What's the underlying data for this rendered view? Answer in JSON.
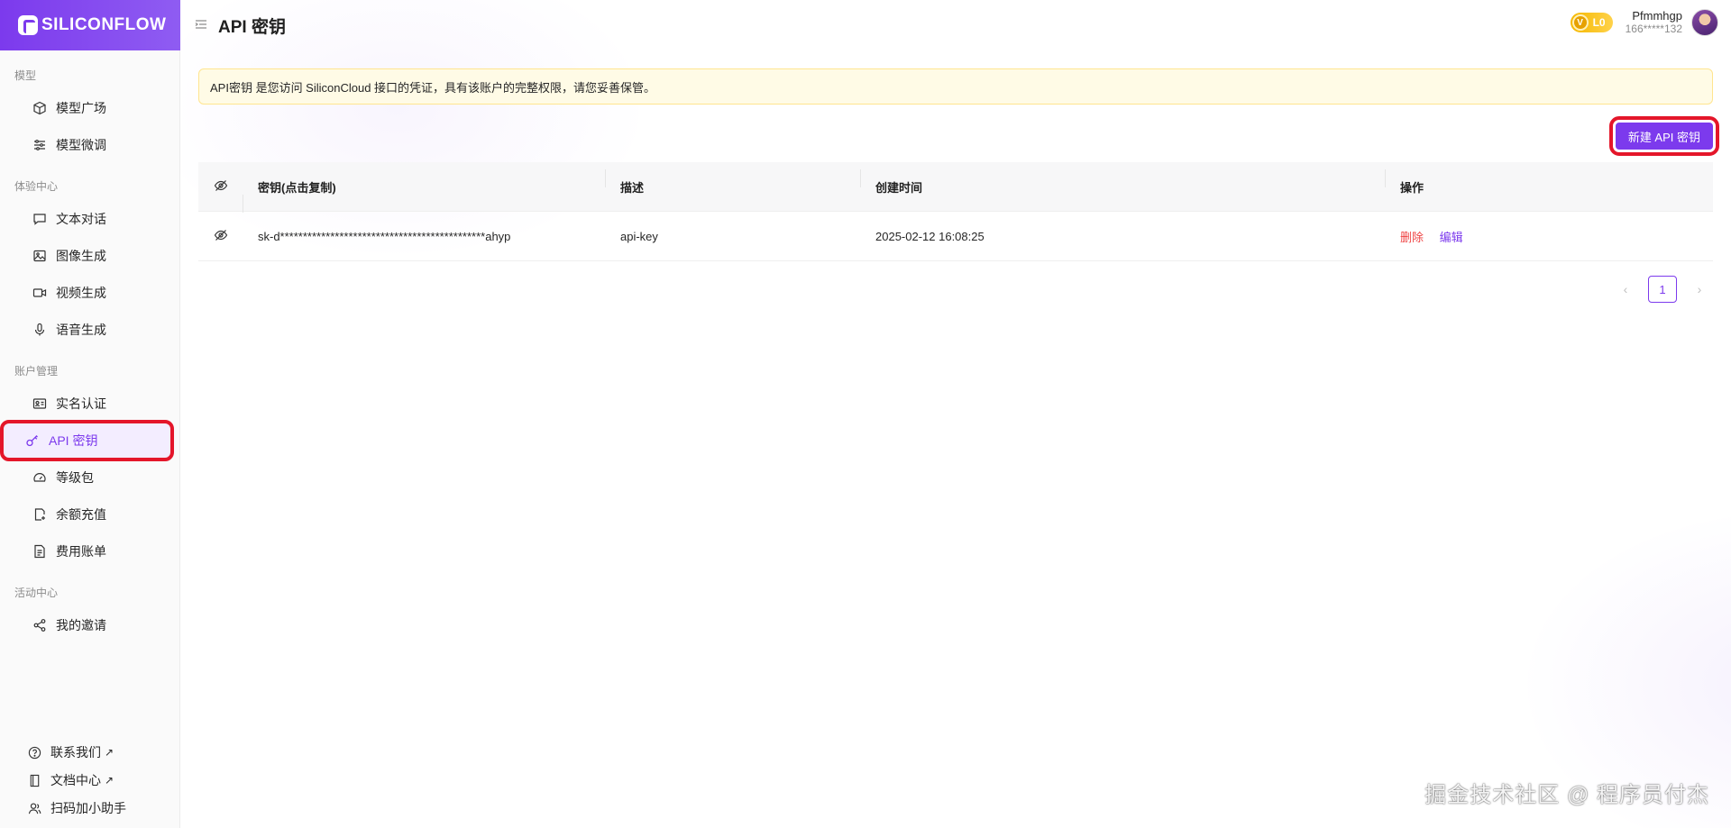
{
  "brand": {
    "name": "SILICONFLOW"
  },
  "sidebar": {
    "sections": [
      {
        "title": "模型",
        "items": [
          {
            "label": "模型广场",
            "icon": "cube-icon"
          },
          {
            "label": "模型微调",
            "icon": "sliders-icon"
          }
        ]
      },
      {
        "title": "体验中心",
        "items": [
          {
            "label": "文本对话",
            "icon": "chat-icon"
          },
          {
            "label": "图像生成",
            "icon": "image-icon"
          },
          {
            "label": "视频生成",
            "icon": "video-icon"
          },
          {
            "label": "语音生成",
            "icon": "mic-icon"
          }
        ]
      },
      {
        "title": "账户管理",
        "items": [
          {
            "label": "实名认证",
            "icon": "id-card-icon"
          },
          {
            "label": "API 密钥",
            "icon": "key-icon",
            "active": true
          },
          {
            "label": "等级包",
            "icon": "gauge-icon"
          },
          {
            "label": "余额充值",
            "icon": "recharge-icon"
          },
          {
            "label": "费用账单",
            "icon": "bill-icon"
          }
        ]
      },
      {
        "title": "活动中心",
        "items": [
          {
            "label": "我的邀请",
            "icon": "share-icon"
          }
        ]
      }
    ],
    "bottom": [
      {
        "label": "联系我们",
        "icon": "help-icon",
        "external": "↗"
      },
      {
        "label": "文档中心",
        "icon": "book-icon",
        "external": "↗"
      },
      {
        "label": "扫码加小助手",
        "icon": "user-icon"
      }
    ]
  },
  "header": {
    "title": "API 密钥",
    "level": "L0",
    "user_name": "Pfmmhgp",
    "user_phone": "166*****132"
  },
  "notice": "API密钥 是您访问 SiliconCloud 接口的凭证，具有该账户的完整权限，请您妥善保管。",
  "new_key_button": "新建 API 密钥",
  "table": {
    "headers": {
      "key": "密钥(点击复制)",
      "desc": "描述",
      "time": "创建时间",
      "actions": "操作"
    },
    "rows": [
      {
        "key": "sk-d*********************************************ahyp",
        "desc": "api-key",
        "time": "2025-02-12 16:08:25",
        "delete": "删除",
        "edit": "编辑"
      }
    ]
  },
  "pagination": {
    "current": "1"
  },
  "watermark": "掘金技术社区 @ 程序员付杰",
  "colors": {
    "accent": "#7c3aed",
    "danger": "#ef4444",
    "highlight": "#e4162a",
    "notice_bg": "#fffbe6"
  }
}
